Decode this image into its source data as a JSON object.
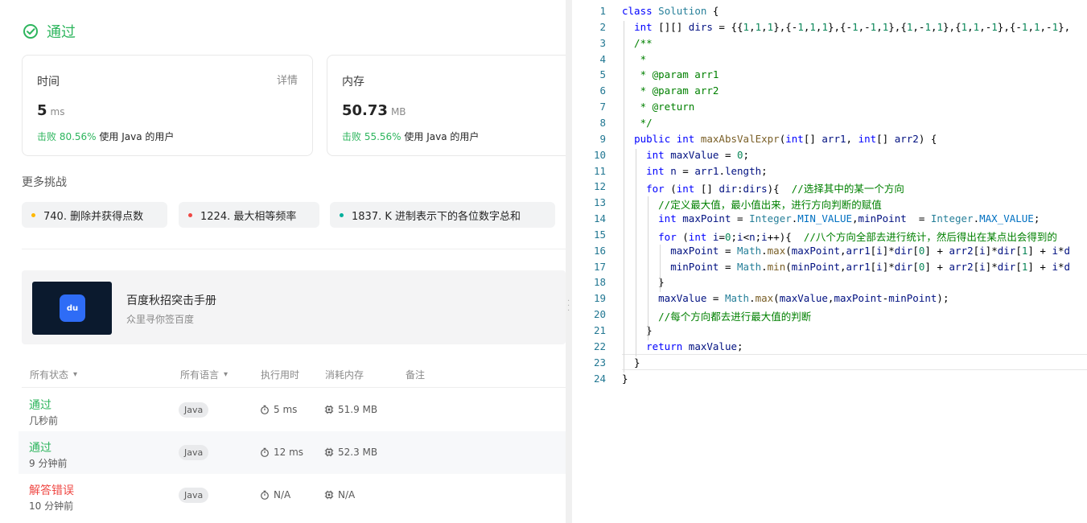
{
  "left": {
    "status": "通过",
    "time_card": {
      "label": "时间",
      "detail": "详情",
      "value": "5",
      "unit": "ms",
      "beat_prefix": "击败 ",
      "beat_pct": "80.56%",
      "beat_suffix": " 使用 Java 的用户"
    },
    "memory_card": {
      "label": "内存",
      "value": "50.73",
      "unit": "MB",
      "beat_prefix": "击败 ",
      "beat_pct": "55.56%",
      "beat_suffix": " 使用 Java 的用户"
    },
    "more_challenges_title": "更多挑战",
    "challenges": [
      {
        "label": "740. 删除并获得点数",
        "color": "#ffb800"
      },
      {
        "label": "1224. 最大相等频率",
        "color": "#ef4743"
      },
      {
        "label": "1837. K 进制表示下的各位数字总和",
        "color": "#00af9b"
      }
    ],
    "ad": {
      "thumb_text": "du",
      "title": "百度秋招突击手册",
      "subtitle": "众里寻你签百度"
    },
    "table": {
      "headers": {
        "status": "所有状态",
        "language": "所有语言",
        "runtime": "执行用时",
        "memory": "消耗内存",
        "note": "备注"
      },
      "rows": [
        {
          "status": "通过",
          "kind": "ok",
          "time": "几秒前",
          "language": "Java",
          "runtime": "5 ms",
          "memory": "51.9 MB"
        },
        {
          "status": "通过",
          "kind": "ok",
          "time": "9 分钟前",
          "language": "Java",
          "runtime": "12 ms",
          "memory": "52.3 MB"
        },
        {
          "status": "解答错误",
          "kind": "err",
          "time": "10 分钟前",
          "language": "Java",
          "runtime": "N/A",
          "memory": "N/A"
        }
      ]
    }
  },
  "editor": {
    "line_numbers": [
      "1",
      "2",
      "3",
      "4",
      "5",
      "6",
      "7",
      "8",
      "9",
      "10",
      "11",
      "12",
      "13",
      "14",
      "15",
      "16",
      "17",
      "18",
      "19",
      "20",
      "21",
      "22",
      "23",
      "24"
    ],
    "lines": [
      "class Solution {",
      "  int [][] dirs = {{1,1,1},{-1,1,1},{-1,-1,1},{1,-1,1},{1,1,-1},{-1,1,-1},",
      "  /**",
      "   *",
      "   * @param arr1",
      "   * @param arr2",
      "   * @return",
      "   */",
      "  public int maxAbsValExpr(int[] arr1, int[] arr2) {",
      "    int maxValue = 0;",
      "    int n = arr1.length;",
      "    for (int [] dir:dirs){  //选择其中的某一个方向",
      "      //定义最大值，最小值出来，进行方向判断的赋值",
      "      int maxPoint = Integer.MIN_VALUE,minPoint  = Integer.MAX_VALUE;",
      "      for (int i=0;i<n;i++){  //八个方向全部去进行统计，然后得出在某点出会得到的",
      "        maxPoint = Math.max(maxPoint,arr1[i]*dir[0] + arr2[i]*dir[1] + i*d",
      "        minPoint = Math.min(minPoint,arr1[i]*dir[0] + arr2[i]*dir[1] + i*d",
      "      }",
      "      maxValue = Math.max(maxValue,maxPoint-minPoint);",
      "      //每个方向都去进行最大值的判断",
      "    }",
      "    return maxValue;",
      "  }",
      "}"
    ]
  }
}
